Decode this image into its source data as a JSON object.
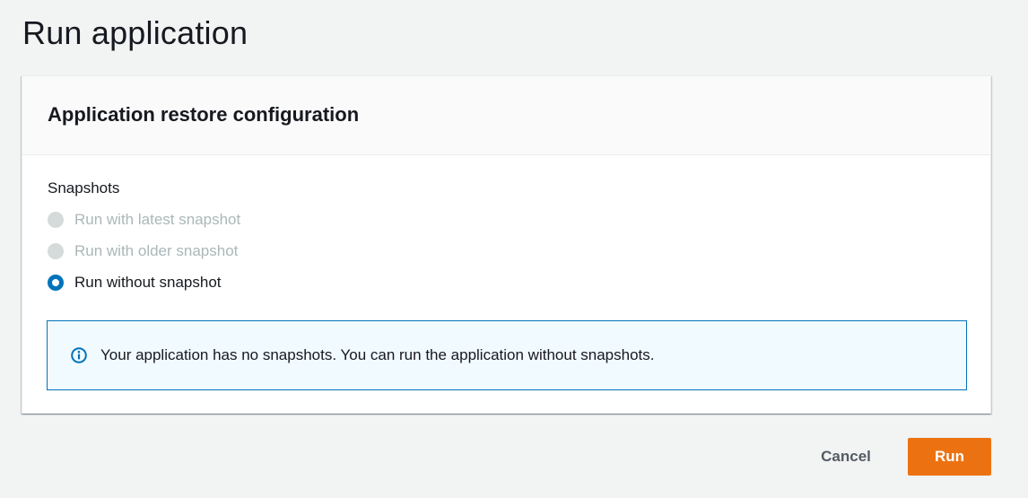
{
  "page": {
    "title": "Run application"
  },
  "panel": {
    "title": "Application restore configuration",
    "snapshots_label": "Snapshots",
    "options": [
      {
        "label": "Run with latest snapshot",
        "disabled": true,
        "checked": false
      },
      {
        "label": "Run with older snapshot",
        "disabled": true,
        "checked": false
      },
      {
        "label": "Run without snapshot",
        "disabled": false,
        "checked": true
      }
    ],
    "info_message": "Your application has no snapshots. You can run the application without snapshots.",
    "info_icon": "info-icon"
  },
  "actions": {
    "cancel_label": "Cancel",
    "run_label": "Run"
  },
  "colors": {
    "accent": "#0073bb",
    "primary_button": "#ec7211",
    "info_background": "#f1faff",
    "disabled": "#aab7b8"
  }
}
